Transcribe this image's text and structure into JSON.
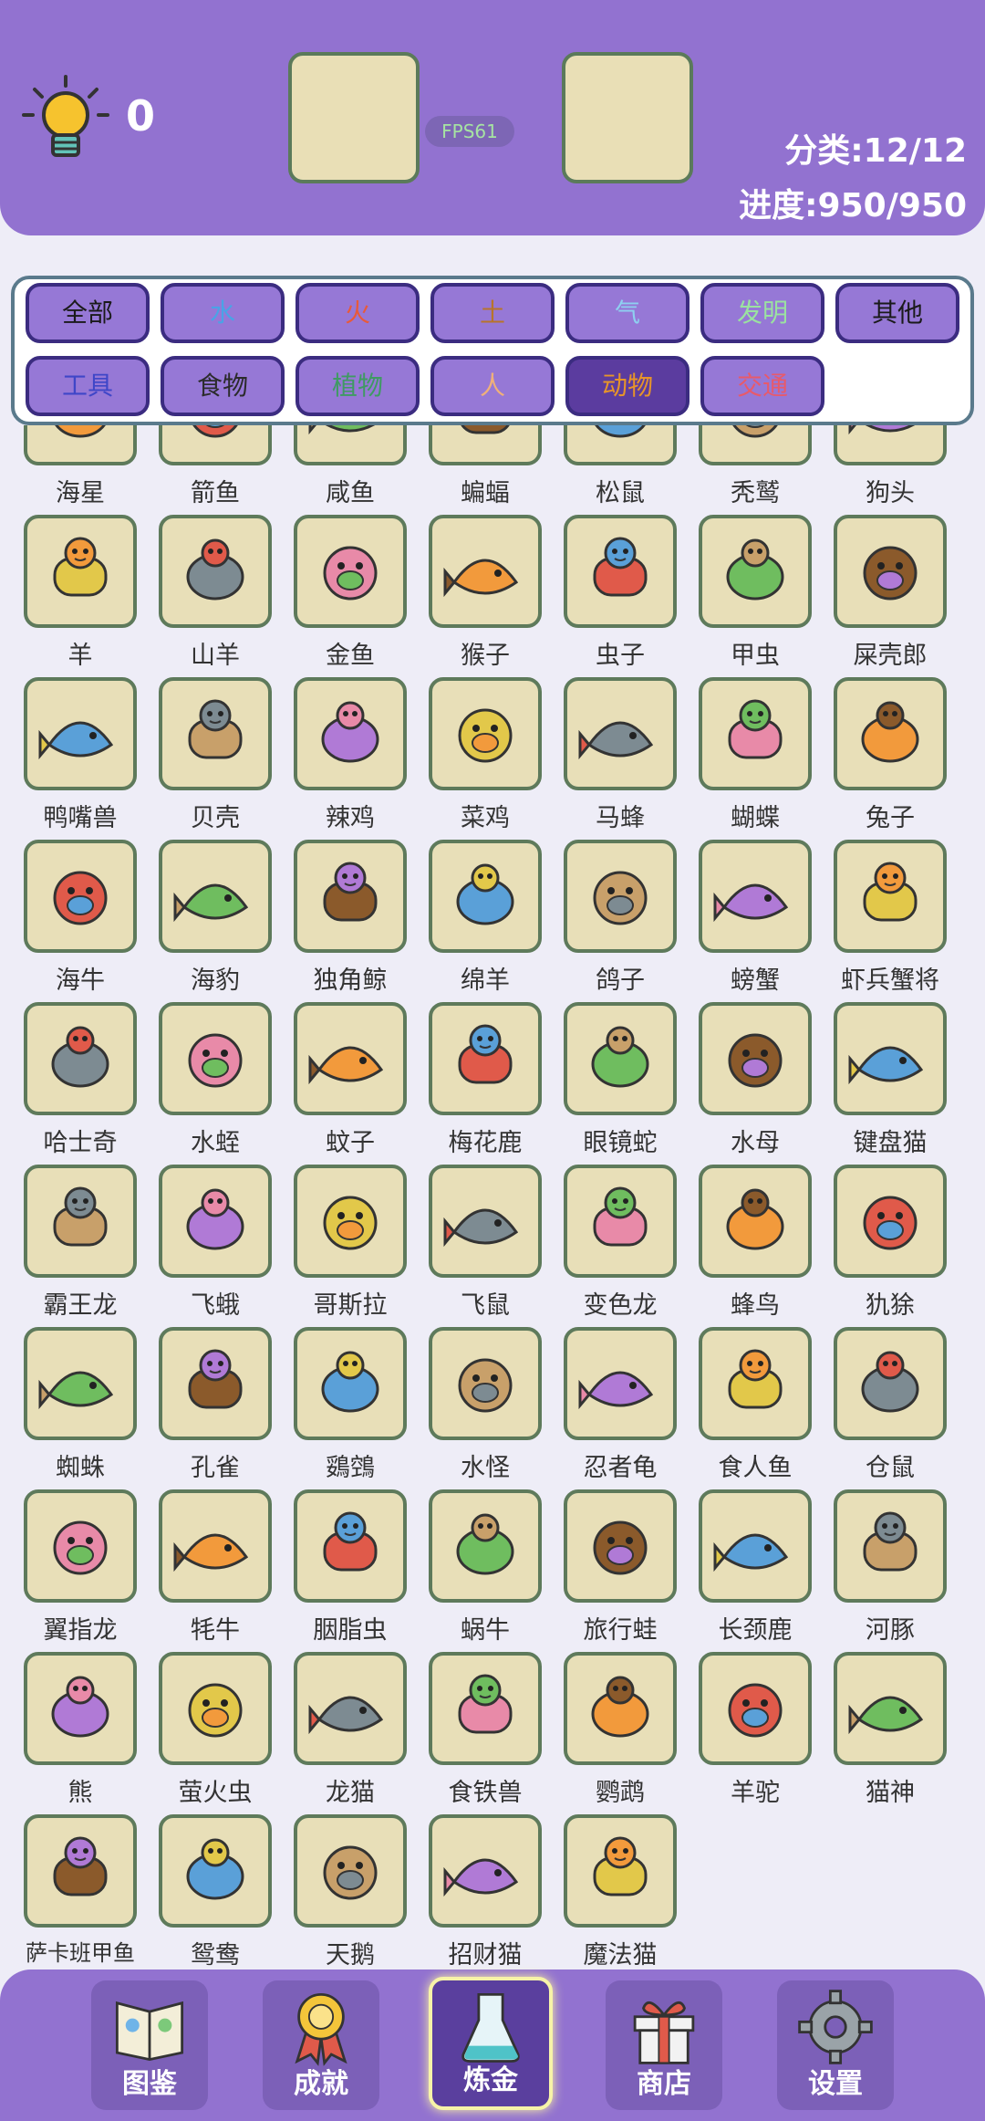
{
  "header": {
    "score": "0",
    "fps": "FPS61",
    "category_progress": "分类:12/12",
    "progress": "进度:950/950"
  },
  "filters": [
    {
      "label": "全部",
      "color": "#1a1a1a"
    },
    {
      "label": "水",
      "color": "#4aa3e6"
    },
    {
      "label": "火",
      "color": "#e85a3a"
    },
    {
      "label": "土",
      "color": "#b8742b"
    },
    {
      "label": "气",
      "color": "#8ed0f0"
    },
    {
      "label": "发明",
      "color": "#9be2a0"
    },
    {
      "label": "其他",
      "color": "#1a1a1a"
    },
    {
      "label": "工具",
      "color": "#3f46c8"
    },
    {
      "label": "食物",
      "color": "#2b2b2b"
    },
    {
      "label": "植物",
      "color": "#3f9a63"
    },
    {
      "label": "人",
      "color": "#f0b07a"
    },
    {
      "label": "动物",
      "color": "#e6942a"
    },
    {
      "label": "交通",
      "color": "#e85a6a"
    }
  ],
  "active_filter": "动物",
  "items": [
    {
      "label": "海星",
      "icon": "starfish-icon"
    },
    {
      "label": "箭鱼",
      "icon": "swordfish-icon"
    },
    {
      "label": "咸鱼",
      "icon": "salted-fish-icon"
    },
    {
      "label": "蝙蝠",
      "icon": "bat-icon"
    },
    {
      "label": "松鼠",
      "icon": "squirrel-icon"
    },
    {
      "label": "秃鹫",
      "icon": "vulture-icon"
    },
    {
      "label": "狗头",
      "icon": "dog-head-icon"
    },
    {
      "label": "羊",
      "icon": "goat-icon"
    },
    {
      "label": "山羊",
      "icon": "mountain-goat-icon"
    },
    {
      "label": "金鱼",
      "icon": "goldfish-icon"
    },
    {
      "label": "猴子",
      "icon": "monkey-icon"
    },
    {
      "label": "虫子",
      "icon": "caterpillar-icon"
    },
    {
      "label": "甲虫",
      "icon": "beetle-icon"
    },
    {
      "label": "屎壳郎",
      "icon": "dung-beetle-icon"
    },
    {
      "label": "鸭嘴兽",
      "icon": "platypus-icon"
    },
    {
      "label": "贝壳",
      "icon": "shell-icon"
    },
    {
      "label": "辣鸡",
      "icon": "chick-icon"
    },
    {
      "label": "菜鸡",
      "icon": "chick-icon"
    },
    {
      "label": "马蜂",
      "icon": "wasp-icon"
    },
    {
      "label": "蝴蝶",
      "icon": "butterfly-icon"
    },
    {
      "label": "兔子",
      "icon": "rabbit-icon"
    },
    {
      "label": "海牛",
      "icon": "manatee-icon"
    },
    {
      "label": "海豹",
      "icon": "seal-icon"
    },
    {
      "label": "独角鲸",
      "icon": "narwhal-icon"
    },
    {
      "label": "绵羊",
      "icon": "sheep-icon"
    },
    {
      "label": "鸽子",
      "icon": "pigeon-icon"
    },
    {
      "label": "螃蟹",
      "icon": "crab-icon"
    },
    {
      "label": "虾兵蟹将",
      "icon": "shrimp-soldiers-icon"
    },
    {
      "label": "哈士奇",
      "icon": "husky-icon"
    },
    {
      "label": "水蛭",
      "icon": "leech-icon"
    },
    {
      "label": "蚊子",
      "icon": "mosquito-icon"
    },
    {
      "label": "梅花鹿",
      "icon": "deer-icon"
    },
    {
      "label": "眼镜蛇",
      "icon": "cobra-icon"
    },
    {
      "label": "水母",
      "icon": "jellyfish-icon"
    },
    {
      "label": "键盘猫",
      "icon": "keyboard-cat-icon"
    },
    {
      "label": "霸王龙",
      "icon": "t-rex-icon"
    },
    {
      "label": "飞蛾",
      "icon": "moth-icon"
    },
    {
      "label": "哥斯拉",
      "icon": "godzilla-icon"
    },
    {
      "label": "飞鼠",
      "icon": "flying-squirrel-icon"
    },
    {
      "label": "变色龙",
      "icon": "chameleon-icon"
    },
    {
      "label": "蜂鸟",
      "icon": "hummingbird-icon"
    },
    {
      "label": "犰狳",
      "icon": "armadillo-icon"
    },
    {
      "label": "蜘蛛",
      "icon": "spider-icon"
    },
    {
      "label": "孔雀",
      "icon": "peacock-icon"
    },
    {
      "label": "鵎鵼",
      "icon": "toucan-icon"
    },
    {
      "label": "水怪",
      "icon": "loch-ness-icon"
    },
    {
      "label": "忍者龟",
      "icon": "turtle-icon"
    },
    {
      "label": "食人鱼",
      "icon": "piranha-icon"
    },
    {
      "label": "仓鼠",
      "icon": "hamster-icon"
    },
    {
      "label": "翼指龙",
      "icon": "pterodactyl-icon"
    },
    {
      "label": "牦牛",
      "icon": "yak-icon"
    },
    {
      "label": "胭脂虫",
      "icon": "cochineal-icon"
    },
    {
      "label": "蜗牛",
      "icon": "snail-icon"
    },
    {
      "label": "旅行蛙",
      "icon": "frog-icon"
    },
    {
      "label": "长颈鹿",
      "icon": "giraffe-icon"
    },
    {
      "label": "河豚",
      "icon": "pufferfish-icon"
    },
    {
      "label": "熊",
      "icon": "bear-icon"
    },
    {
      "label": "萤火虫",
      "icon": "firefly-icon"
    },
    {
      "label": "龙猫",
      "icon": "totoro-icon"
    },
    {
      "label": "食铁兽",
      "icon": "panda-icon"
    },
    {
      "label": "鹦鹉",
      "icon": "parrot-icon"
    },
    {
      "label": "羊驼",
      "icon": "alpaca-icon"
    },
    {
      "label": "猫神",
      "icon": "pharaoh-cat-icon"
    },
    {
      "label": "萨卡班甲鱼",
      "icon": "sacabambaspis-icon"
    },
    {
      "label": "鸳鸯",
      "icon": "mandarin-duck-icon"
    },
    {
      "label": "天鹅",
      "icon": "swan-icon"
    },
    {
      "label": "招财猫",
      "icon": "lucky-cat-icon"
    },
    {
      "label": "魔法猫",
      "icon": "magic-cat-icon"
    }
  ],
  "nav": [
    {
      "label": "图鉴",
      "icon": "book-icon"
    },
    {
      "label": "成就",
      "icon": "medal-icon"
    },
    {
      "label": "炼金",
      "icon": "flask-icon"
    },
    {
      "label": "商店",
      "icon": "gift-icon"
    },
    {
      "label": "设置",
      "icon": "gear-icon"
    }
  ],
  "active_nav": "炼金",
  "colors": {
    "primary": "#9272d0",
    "tile": "#e8dfb8",
    "tile_border": "#5e7a5b",
    "button_border": "#3b2c80"
  }
}
